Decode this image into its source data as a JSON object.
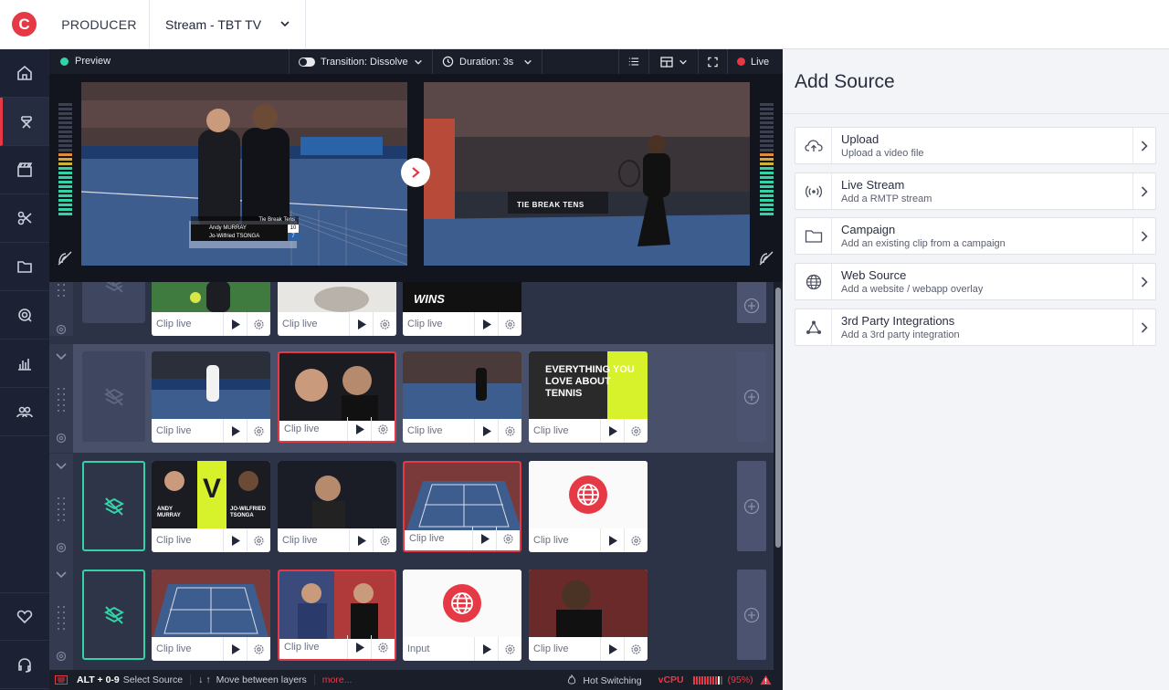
{
  "app": {
    "brand_letter": "C"
  },
  "header": {
    "producer_label": "PRODUCER",
    "stream_title": "Stream - TBT TV"
  },
  "toolbar": {
    "preview_label": "Preview",
    "transition_label": "Transition: Dissolve",
    "duration_label": "Duration: 3s",
    "live_label": "Live"
  },
  "video": {
    "score_title": "Tie Break Tens",
    "player1": "Andy MURRAY",
    "score1": "10",
    "player2": "Jo-Wilfried TSONGA",
    "score2": "7",
    "ad_text": "TIE BREAK TENS"
  },
  "grid": {
    "rows": [
      {
        "cards": [
          {
            "label": "Clip live"
          },
          {
            "label": "Clip live"
          },
          {
            "label": "Clip live",
            "overlay": "WINS"
          }
        ]
      },
      {
        "cards": [
          {
            "label": "Clip live"
          },
          {
            "label": "Clip live"
          },
          {
            "label": "Clip live"
          },
          {
            "label": "Clip live",
            "overlay": "EVERYTHING YOU LOVE ABOUT TENNIS"
          }
        ]
      },
      {
        "cards": [
          {
            "label": "Clip live",
            "overlay_left": "ANDY MURRAY",
            "overlay_right": "JO-WILFRIED TSONGA"
          },
          {
            "label": "Clip live"
          },
          {
            "label": "Clip live"
          },
          {
            "label": "Clip live"
          }
        ]
      },
      {
        "cards": [
          {
            "label": "Clip live"
          },
          {
            "label": "Clip live"
          },
          {
            "label": "Input"
          },
          {
            "label": "Clip live"
          }
        ]
      }
    ]
  },
  "status": {
    "kbd1": "ALT + 0-9",
    "kbd1_desc": "Select Source",
    "kbd2_desc": "Move between layers",
    "more": "more...",
    "hot_switching": "Hot Switching",
    "vcpu_label": "vCPU",
    "vcpu_value": "(95%)"
  },
  "panel": {
    "title": "Add Source",
    "sources": [
      {
        "title": "Upload",
        "subtitle": "Upload a video file",
        "icon": "cloud-upload-icon"
      },
      {
        "title": "Live Stream",
        "subtitle": "Add a RMTP stream",
        "icon": "broadcast-icon"
      },
      {
        "title": "Campaign",
        "subtitle": "Add an existing clip from a campaign",
        "icon": "folder-icon"
      },
      {
        "title": "Web Source",
        "subtitle": "Add a website / webapp overlay",
        "icon": "globe-icon"
      },
      {
        "title": "3rd Party Integrations",
        "subtitle": "Add a 3rd party integration",
        "icon": "integration-icon"
      }
    ]
  },
  "colors": {
    "accent_red": "#e63946",
    "accent_green": "#34d3a6",
    "volt": "#d7f22b",
    "court_blue": "#3e5d8f"
  }
}
